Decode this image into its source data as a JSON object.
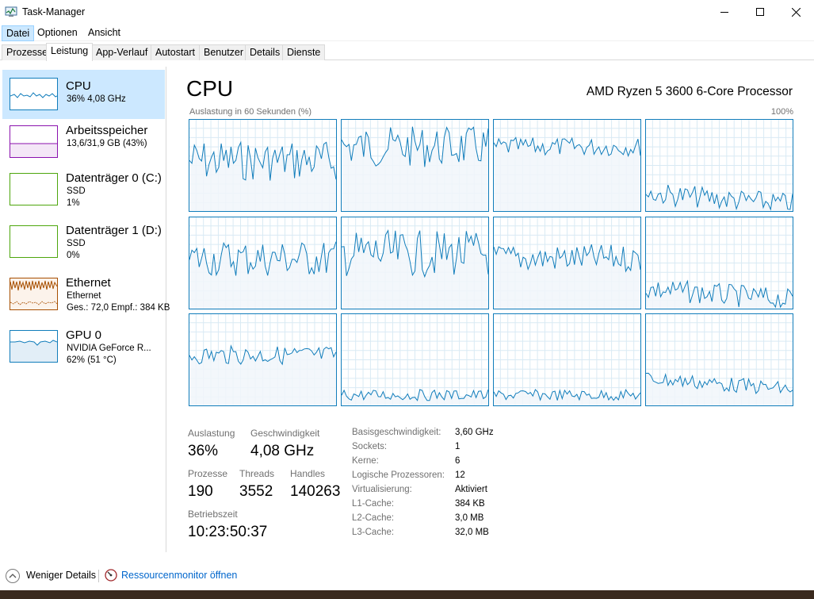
{
  "window": {
    "title": "Task-Manager"
  },
  "menu": [
    {
      "label": "Datei",
      "active": true
    },
    {
      "label": "Optionen",
      "active": false
    },
    {
      "label": "Ansicht",
      "active": false
    }
  ],
  "tabs": [
    {
      "label": "Prozesse",
      "active": false
    },
    {
      "label": "Leistung",
      "active": true
    },
    {
      "label": "App-Verlauf",
      "active": false
    },
    {
      "label": "Autostart",
      "active": false
    },
    {
      "label": "Benutzer",
      "active": false
    },
    {
      "label": "Details",
      "active": false
    },
    {
      "label": "Dienste",
      "active": false
    }
  ],
  "sidebar": [
    {
      "title": "CPU",
      "lines": [
        "36% 4,08 GHz"
      ],
      "selected": true,
      "color": "#117dbb"
    },
    {
      "title": "Arbeitsspeicher",
      "lines": [
        "13,6/31,9 GB (43%)"
      ],
      "selected": false,
      "color": "#8b12ae"
    },
    {
      "title": "Datenträger 0 (C:)",
      "lines": [
        "SSD",
        "1%"
      ],
      "selected": false,
      "color": "#4da60c"
    },
    {
      "title": "Datenträger 1 (D:)",
      "lines": [
        "SSD",
        "0%"
      ],
      "selected": false,
      "color": "#4da60c"
    },
    {
      "title": "Ethernet",
      "lines": [
        "Ethernet",
        "Ges.: 72,0 Empf.: 384 KB"
      ],
      "selected": false,
      "color": "#a74f01"
    },
    {
      "title": "GPU 0",
      "lines": [
        "NVIDIA GeForce R...",
        "62% (51 °C)"
      ],
      "selected": false,
      "color": "#117dbb"
    }
  ],
  "main": {
    "title": "CPU",
    "processor": "AMD Ryzen 5 3600 6-Core Processor",
    "graph_label": "Auslastung in 60 Sekunden (%)",
    "graph_max": "100%"
  },
  "stats": {
    "utilization": {
      "label": "Auslastung",
      "value": "36%"
    },
    "speed": {
      "label": "Geschwindigkeit",
      "value": "4,08 GHz"
    },
    "processes": {
      "label": "Prozesse",
      "value": "190"
    },
    "threads": {
      "label": "Threads",
      "value": "3552"
    },
    "handles": {
      "label": "Handles",
      "value": "140263"
    },
    "uptime": {
      "label": "Betriebszeit",
      "value": "10:23:50:37"
    }
  },
  "specs": [
    {
      "label": "Basisgeschwindigkeit:",
      "value": "3,60 GHz"
    },
    {
      "label": "Sockets:",
      "value": "1"
    },
    {
      "label": "Kerne:",
      "value": "6"
    },
    {
      "label": "Logische Prozessoren:",
      "value": "12"
    },
    {
      "label": "Virtualisierung:",
      "value": "Aktiviert"
    },
    {
      "label": "L1-Cache:",
      "value": "384 KB"
    },
    {
      "label": "L2-Cache:",
      "value": "3,0 MB"
    },
    {
      "label": "L3-Cache:",
      "value": "32,0 MB"
    }
  ],
  "footer": {
    "fewer_details": "Weniger Details",
    "resource_monitor": "Ressourcenmonitor öffnen"
  },
  "colors": {
    "cpu_line": "#117dbb",
    "cpu_fill": "#f1f6fa",
    "cpu_grid": "#d9eaf4",
    "link": "#0066cc"
  }
}
